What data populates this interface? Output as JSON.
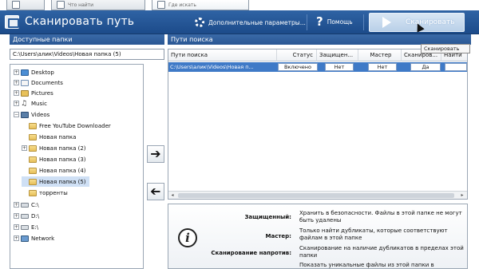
{
  "tabs": [
    {
      "label": ""
    },
    {
      "label": "Что найти"
    },
    {
      "label": "Где искать"
    }
  ],
  "toolbar": {
    "title": "Сканировать путь",
    "params_label": "Дополнительные параметры...",
    "help_label": "Помощь",
    "scan_label": "Сканировать",
    "scan_tooltip": "Сканировать"
  },
  "left_panel": {
    "header": "Доступные папки",
    "path_value": "C:\\Users\\алик\\Videos\\Новая папка (5)",
    "tree": [
      {
        "label": "Desktop",
        "icon": "desktop-icon",
        "expander": "+"
      },
      {
        "label": "Documents",
        "icon": "documents-icon",
        "expander": "+"
      },
      {
        "label": "Pictures",
        "icon": "pictures-icon",
        "expander": "+"
      },
      {
        "label": "Music",
        "icon": "music-icon",
        "expander": "+"
      },
      {
        "label": "Videos",
        "icon": "videos-icon",
        "expander": "−"
      },
      {
        "label": "Free YouTube Downloader",
        "icon": "folder-icon",
        "expander": ""
      },
      {
        "label": "Новая папка",
        "icon": "folder-icon",
        "expander": ""
      },
      {
        "label": "Новая папка (2)",
        "icon": "folder-icon",
        "expander": "+"
      },
      {
        "label": "Новая папка (3)",
        "icon": "folder-icon",
        "expander": ""
      },
      {
        "label": "Новая папка (4)",
        "icon": "folder-icon",
        "expander": ""
      },
      {
        "label": "Новая папка (5)",
        "icon": "folder-icon",
        "expander": ""
      },
      {
        "label": "торренты",
        "icon": "folder-icon",
        "expander": ""
      },
      {
        "label": "C:\\",
        "icon": "drive-icon",
        "expander": "+"
      },
      {
        "label": "D:\\",
        "icon": "drive-icon",
        "expander": "+"
      },
      {
        "label": "E:\\",
        "icon": "drive-icon",
        "expander": "+"
      },
      {
        "label": "Network",
        "icon": "network-icon",
        "expander": "+"
      }
    ]
  },
  "right_panel": {
    "header": "Пути поиска",
    "columns": [
      "Пути поиска",
      "Статус",
      "Защищен...",
      "Мастер",
      "Сканиров...",
      "Найти"
    ],
    "rows": [
      {
        "path": "C:\\Users\\алик\\Videos\\Новая п...",
        "status": "Включено",
        "protected": "Нет",
        "master": "Нет",
        "scan": "Да",
        "find": ""
      }
    ]
  },
  "info": {
    "rows": [
      {
        "key": "Защищенный:",
        "value": "Хранить в безопасности. Файлы в этой папке не могут быть удалены"
      },
      {
        "key": "Мастер:",
        "value": "Только найти дубликаты, которые соответствуют файлам в этой папке"
      },
      {
        "key": "Сканирование напротив:",
        "value": "Сканирование на наличие дубликатов в пределах этой папки"
      },
      {
        "key": "",
        "value": "Показать уникальные файлы из этой папки в"
      }
    ]
  },
  "colors": {
    "toolbar_blue": "#2a5a9a",
    "panel_header_blue": "#2f5f9d",
    "selection_blue": "#3f7ac7"
  }
}
